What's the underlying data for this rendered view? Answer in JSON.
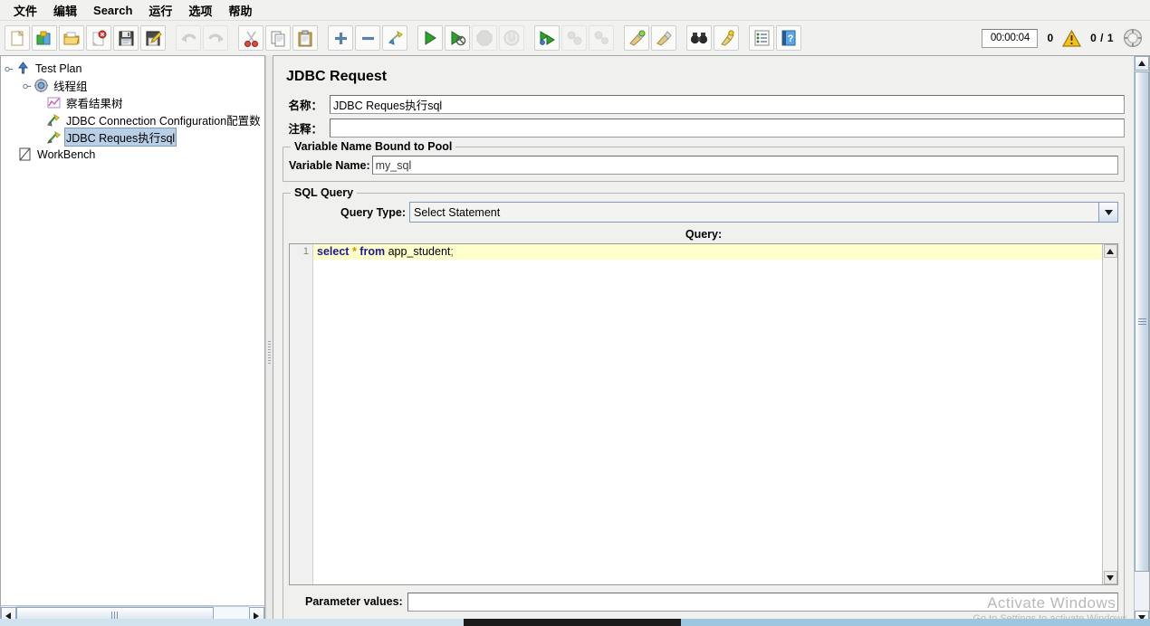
{
  "menubar": {
    "items": [
      {
        "label": "文件",
        "name": "menu-file"
      },
      {
        "label": "编辑",
        "name": "menu-edit"
      },
      {
        "label": "Search",
        "name": "menu-search"
      },
      {
        "label": "运行",
        "name": "menu-run"
      },
      {
        "label": "选项",
        "name": "menu-options"
      },
      {
        "label": "帮助",
        "name": "menu-help"
      }
    ]
  },
  "toolbar": {
    "buttons": [
      {
        "icon": "new-file-icon",
        "enabled": true
      },
      {
        "icon": "templates-icon",
        "enabled": true
      },
      {
        "icon": "open-folder-icon",
        "enabled": true
      },
      {
        "icon": "close-icon",
        "enabled": true
      },
      {
        "icon": "save-icon",
        "enabled": true
      },
      {
        "icon": "save-as-icon",
        "enabled": true
      },
      {
        "icon": "undo-icon",
        "enabled": false
      },
      {
        "icon": "redo-icon",
        "enabled": false
      },
      {
        "icon": "cut-icon",
        "enabled": true
      },
      {
        "icon": "copy-icon",
        "enabled": true
      },
      {
        "icon": "paste-icon",
        "enabled": true
      },
      {
        "icon": "expand-all-icon",
        "enabled": true
      },
      {
        "icon": "collapse-all-icon",
        "enabled": true
      },
      {
        "icon": "toggle-icon",
        "enabled": true
      },
      {
        "icon": "start-icon",
        "enabled": true
      },
      {
        "icon": "start-no-pauses-icon",
        "enabled": true
      },
      {
        "icon": "stop-icon",
        "enabled": false
      },
      {
        "icon": "shutdown-icon",
        "enabled": false
      },
      {
        "icon": "remote-start-all-icon",
        "enabled": true
      },
      {
        "icon": "remote-stop-all-icon",
        "enabled": false
      },
      {
        "icon": "remote-shutdown-all-icon",
        "enabled": false
      },
      {
        "icon": "clear-icon",
        "enabled": true
      },
      {
        "icon": "clear-all-icon",
        "enabled": true
      },
      {
        "icon": "search-icon",
        "enabled": true
      },
      {
        "icon": "search-reset-icon",
        "enabled": true
      },
      {
        "icon": "function-helper-icon",
        "enabled": true
      },
      {
        "icon": "help-icon",
        "enabled": true
      }
    ],
    "status": {
      "timer": "00:00:04",
      "error_count": "0",
      "warning_icon": "warning-triangle-icon",
      "threads": "0 / 1",
      "activity_icon": "activity-indicator-icon"
    }
  },
  "tree": {
    "nodes": [
      {
        "label": "Test Plan",
        "icon": "test-plan-icon",
        "depth": 0,
        "selected": false,
        "name": "tree-node-test-plan"
      },
      {
        "label": "线程组",
        "icon": "thread-group-icon",
        "depth": 1,
        "selected": false,
        "name": "tree-node-thread-group"
      },
      {
        "label": "察看结果树",
        "icon": "view-results-tree-icon",
        "depth": 2,
        "selected": false,
        "name": "tree-node-view-results-tree"
      },
      {
        "label": "JDBC Connection Configuration配置数",
        "icon": "jdbc-connection-config-icon",
        "depth": 2,
        "selected": false,
        "name": "tree-node-jdbc-connection-configuration"
      },
      {
        "label": "JDBC Reques执行sql",
        "icon": "jdbc-request-icon",
        "depth": 2,
        "selected": true,
        "name": "tree-node-jdbc-request"
      },
      {
        "label": "WorkBench",
        "icon": "workbench-icon",
        "depth": 0,
        "selected": false,
        "name": "tree-node-workbench"
      }
    ]
  },
  "panel": {
    "title": "JDBC Request",
    "name_label": "名称：",
    "name_value": "JDBC Reques执行sql",
    "comment_label": "注释：",
    "comment_value": "",
    "variable_group_title": "Variable Name Bound to Pool",
    "variable_name_label": "Variable Name:",
    "variable_name_value": "my_sql",
    "sql_group_title": "SQL Query",
    "query_type_label": "Query Type:",
    "query_type_value": "Select Statement",
    "query_caption": "Query:",
    "editor": {
      "line_number": "1",
      "tokens": [
        {
          "text": "select",
          "type": "keyword"
        },
        {
          "text": " ",
          "type": "plain"
        },
        {
          "text": "*",
          "type": "operator"
        },
        {
          "text": " ",
          "type": "plain"
        },
        {
          "text": "from",
          "type": "keyword"
        },
        {
          "text": " ",
          "type": "plain"
        },
        {
          "text": "app_student",
          "type": "identifier"
        },
        {
          "text": ";",
          "type": "punctuation"
        }
      ],
      "full_text": "select * from app_student;"
    },
    "parameter_values_label": "Parameter values:",
    "parameter_values_value": ""
  },
  "watermark": {
    "line1": "Activate Windows",
    "line2": "Go to Settings to activate Windows."
  },
  "colors": {
    "selection": "#b8cfe5",
    "editor_line": "#ffffcc",
    "keyword": "#1a1a8c",
    "operator": "#d48f00",
    "warning": "#f5c518",
    "scrollbar": "#cfdcea"
  }
}
